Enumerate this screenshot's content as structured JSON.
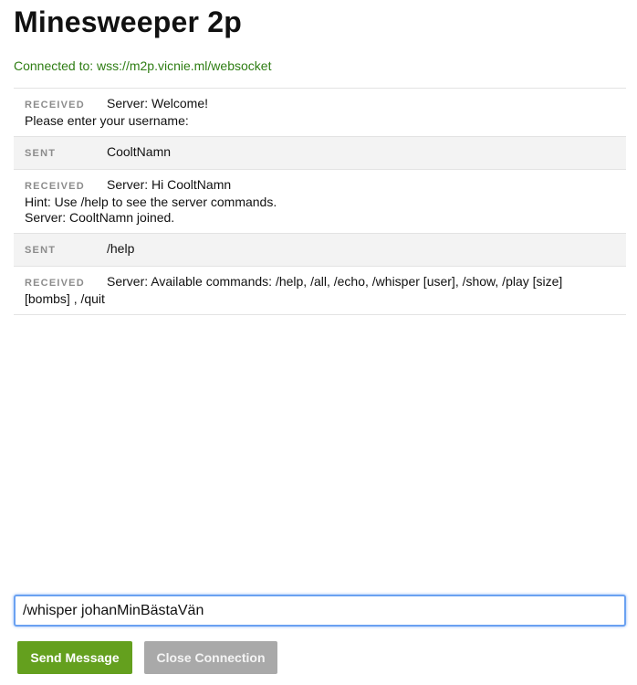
{
  "page": {
    "title": "Minesweeper 2p",
    "status": "Connected to: wss://m2p.vicnie.ml/websocket"
  },
  "log": {
    "messages": [
      {
        "type": "RECEIVED",
        "text": "Server: Welcome!\nPlease enter your username:"
      },
      {
        "type": "SENT",
        "text": "CooltNamn"
      },
      {
        "type": "RECEIVED",
        "text": "Server: Hi CooltNamn\nHint: Use /help to see the server commands.\nServer: CooltNamn joined."
      },
      {
        "type": "SENT",
        "text": "/help"
      },
      {
        "type": "RECEIVED",
        "text": "Server: Available commands: /help, /all, /echo, /whisper [user], /show, /play [size]\n[bombs] , /quit"
      }
    ]
  },
  "composer": {
    "value": "/whisper johanMinBästaVän",
    "send_label": "Send Message",
    "close_label": "Close Connection"
  },
  "colors": {
    "status": "#2e7d13",
    "send_button": "#64a01e",
    "close_button": "#a9a9a9",
    "sent_row_bg": "#f3f3f3",
    "input_focus": "#6aa1f1"
  }
}
